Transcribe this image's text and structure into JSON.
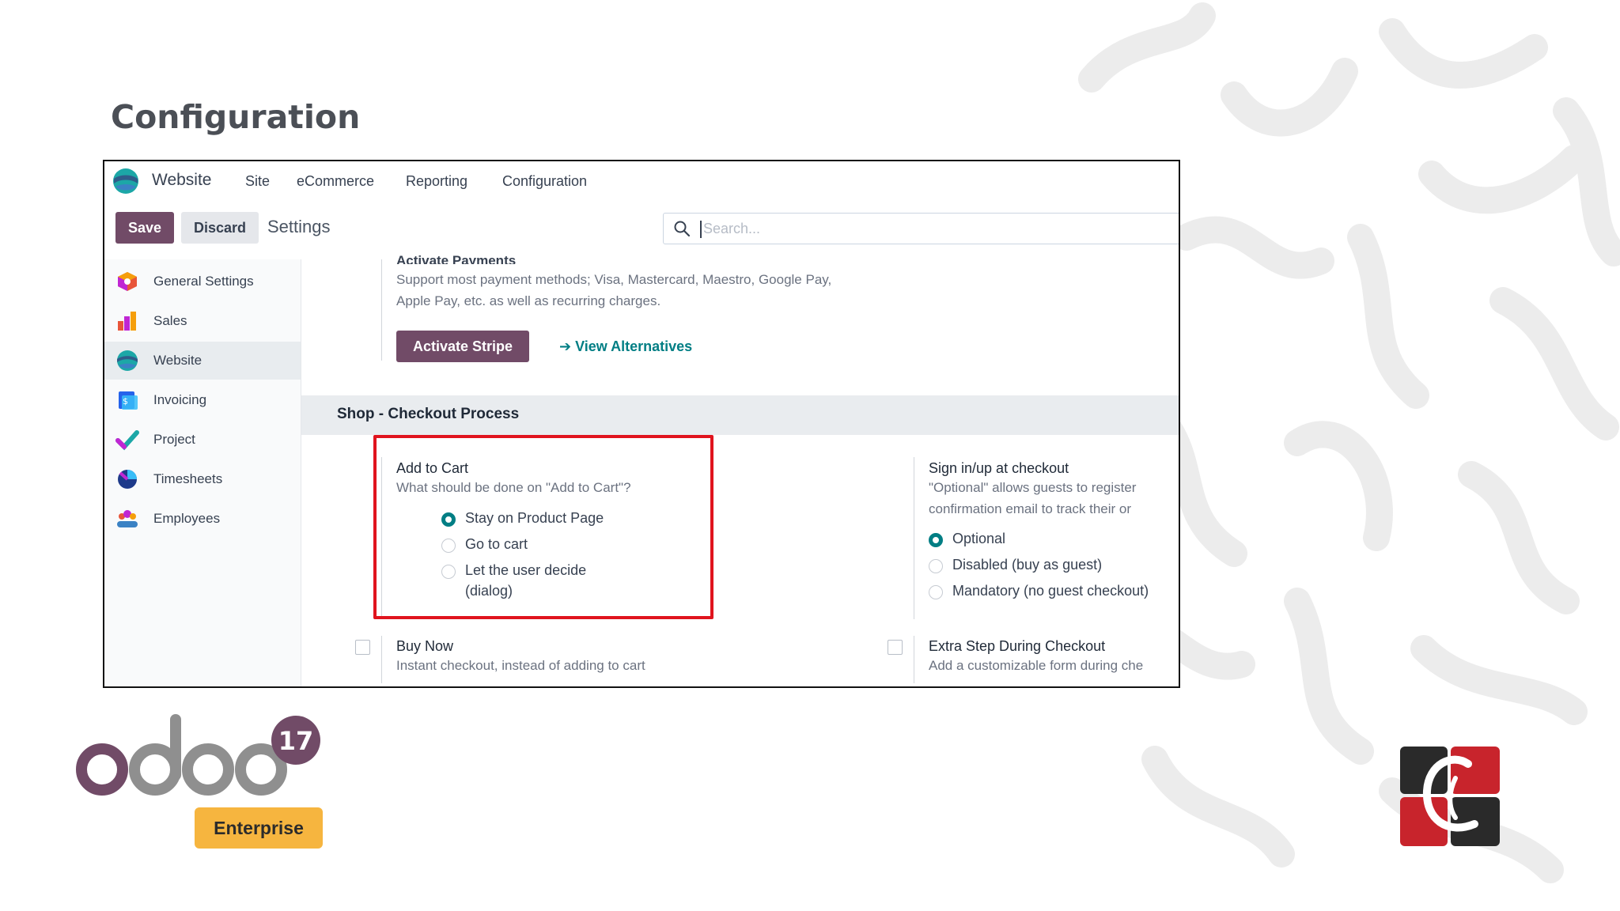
{
  "slide": {
    "title": "Configuration"
  },
  "navbar": {
    "app_name": "Website",
    "menus": [
      "Site",
      "eCommerce",
      "Reporting",
      "Configuration"
    ]
  },
  "control_panel": {
    "save_label": "Save",
    "discard_label": "Discard",
    "title": "Settings",
    "search_placeholder": "Search..."
  },
  "sidebar": {
    "items": [
      {
        "label": "General Settings",
        "icon": "general-settings-icon"
      },
      {
        "label": "Sales",
        "icon": "sales-icon"
      },
      {
        "label": "Website",
        "icon": "website-icon",
        "active": true
      },
      {
        "label": "Invoicing",
        "icon": "invoicing-icon"
      },
      {
        "label": "Project",
        "icon": "project-icon"
      },
      {
        "label": "Timesheets",
        "icon": "timesheets-icon"
      },
      {
        "label": "Employees",
        "icon": "employees-icon"
      }
    ]
  },
  "payments": {
    "title_cut": "Activate Payments",
    "description": "Support most payment methods; Visa, Mastercard, Maestro, Google Pay, Apple Pay, etc. as well as recurring charges.",
    "activate_label": "Activate Stripe",
    "alternatives_label": "View Alternatives"
  },
  "section": {
    "title": "Shop - Checkout Process"
  },
  "add_to_cart": {
    "title": "Add to Cart",
    "description": "What should be done on \"Add to Cart\"?",
    "options": [
      "Stay on Product Page",
      "Go to cart",
      "Let the user decide",
      "(dialog)"
    ],
    "selected": "Stay on Product Page"
  },
  "sign_in": {
    "title": "Sign in/up at checkout",
    "description_line1": "\"Optional\" allows guests to register",
    "description_line2": "confirmation email to track their or",
    "options": [
      "Optional",
      "Disabled (buy as guest)",
      "Mandatory (no guest checkout)"
    ],
    "selected": "Optional"
  },
  "buy_now": {
    "title": "Buy Now",
    "description": "Instant checkout, instead of adding to cart",
    "checked": false
  },
  "extra_step": {
    "title": "Extra Step During Checkout",
    "description": "Add a customizable form during che",
    "checked": false
  },
  "branding": {
    "badge_number": "17",
    "edition_label": "Enterprise",
    "accent_color": "#714b67",
    "link_color": "#017e84",
    "highlight_color": "#e0141e"
  }
}
